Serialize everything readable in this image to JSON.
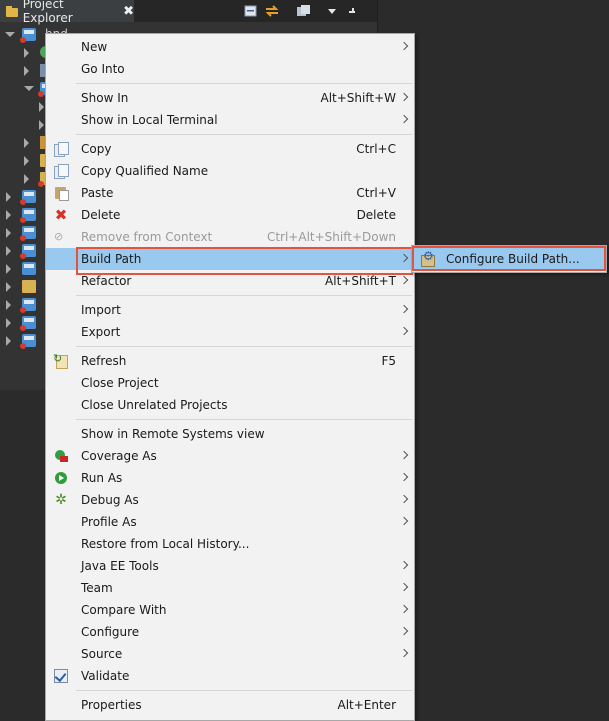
{
  "explorer": {
    "tab_title": "Project Explorer",
    "project_name_partial": "hnd-KM"
  },
  "context_menu": {
    "items": [
      {
        "label": "New",
        "accel": "",
        "submenu": true
      },
      {
        "label": "Go Into",
        "accel": ""
      },
      {
        "label": "Show In",
        "accel": "Alt+Shift+W",
        "submenu": true
      },
      {
        "label": "Show in Local Terminal",
        "accel": "",
        "submenu": true
      },
      {
        "label": "Copy",
        "accel": "Ctrl+C",
        "icon": "copy-icon"
      },
      {
        "label": "Copy Qualified Name",
        "accel": "",
        "icon": "copy-qualified-icon"
      },
      {
        "label": "Paste",
        "accel": "Ctrl+V",
        "icon": "paste-icon"
      },
      {
        "label": "Delete",
        "accel": "Delete",
        "icon": "delete-icon"
      },
      {
        "label": "Remove from Context",
        "accel": "Ctrl+Alt+Shift+Down",
        "disabled": true,
        "icon": "remove-context-icon"
      },
      {
        "label": "Build Path",
        "accel": "",
        "submenu": true,
        "highlighted": true
      },
      {
        "label": "Refactor",
        "accel": "Alt+Shift+T",
        "submenu": true
      },
      {
        "label": "Import",
        "accel": "",
        "submenu": true
      },
      {
        "label": "Export",
        "accel": "",
        "submenu": true
      },
      {
        "label": "Refresh",
        "accel": "F5",
        "icon": "refresh-icon"
      },
      {
        "label": "Close Project",
        "accel": ""
      },
      {
        "label": "Close Unrelated Projects",
        "accel": ""
      },
      {
        "label": "Show in Remote Systems view",
        "accel": ""
      },
      {
        "label": "Coverage As",
        "accel": "",
        "submenu": true,
        "icon": "coverage-icon"
      },
      {
        "label": "Run As",
        "accel": "",
        "submenu": true,
        "icon": "run-icon"
      },
      {
        "label": "Debug As",
        "accel": "",
        "submenu": true,
        "icon": "debug-icon"
      },
      {
        "label": "Profile As",
        "accel": "",
        "submenu": true
      },
      {
        "label": "Restore from Local History...",
        "accel": ""
      },
      {
        "label": "Java EE Tools",
        "accel": "",
        "submenu": true
      },
      {
        "label": "Team",
        "accel": "",
        "submenu": true
      },
      {
        "label": "Compare With",
        "accel": "",
        "submenu": true
      },
      {
        "label": "Configure",
        "accel": "",
        "submenu": true
      },
      {
        "label": "Source",
        "accel": "",
        "submenu": true
      },
      {
        "label": "Validate",
        "accel": "",
        "icon": "validate-check-icon"
      },
      {
        "label": "Properties",
        "accel": "Alt+Enter"
      }
    ]
  },
  "build_path_submenu": {
    "items": [
      {
        "label": "Configure Build Path...",
        "icon": "configure-build-path-icon"
      }
    ]
  },
  "colors": {
    "highlight": "#99c9ef",
    "annotation_box": "#e2543e",
    "menu_bg": "#f2f2f2",
    "ide_bg": "#2b2b2b"
  }
}
